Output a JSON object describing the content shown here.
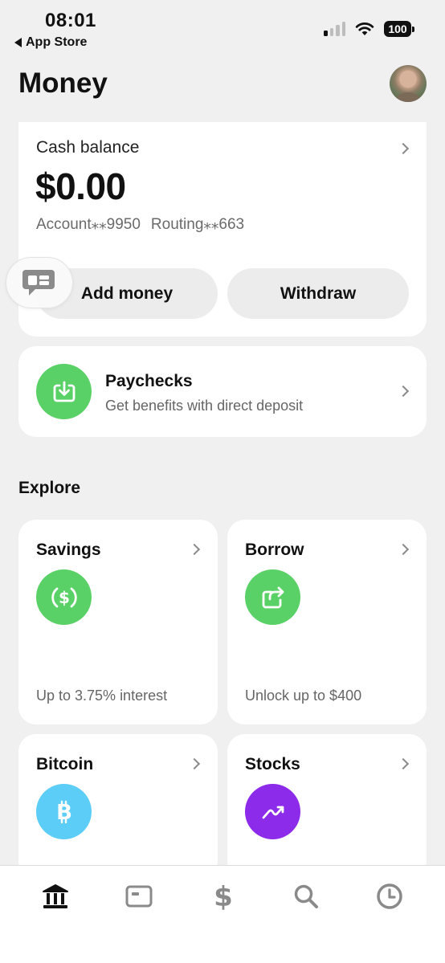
{
  "status": {
    "time": "08:01",
    "back_label": "App Store",
    "battery": "100"
  },
  "header": {
    "title": "Money"
  },
  "cash": {
    "label": "Cash balance",
    "amount": "$0.00",
    "account": "Account⁎⁎9950",
    "routing": "Routing⁎⁎663",
    "add_money": "Add money",
    "withdraw": "Withdraw"
  },
  "paychecks": {
    "title": "Paychecks",
    "subtitle": "Get benefits with direct deposit"
  },
  "explore": {
    "title": "Explore",
    "tiles": [
      {
        "title": "Savings",
        "subtitle": "Up to 3.75% interest",
        "icon": "dollar-circle-icon",
        "color": "#5ad166"
      },
      {
        "title": "Borrow",
        "subtitle": "Unlock up to $400",
        "icon": "borrow-arrow-icon",
        "color": "#5ad166"
      },
      {
        "title": "Bitcoin",
        "subtitle": "",
        "icon": "bitcoin-icon",
        "color": "#5ccdf6"
      },
      {
        "title": "Stocks",
        "subtitle": "",
        "icon": "stocks-trend-icon",
        "color": "#8c2bea"
      }
    ]
  },
  "tabbar": {
    "items": [
      {
        "name": "money",
        "icon": "bank-icon",
        "active": true
      },
      {
        "name": "card",
        "icon": "card-icon",
        "active": false
      },
      {
        "name": "pay",
        "icon": "dollar-icon",
        "active": false
      },
      {
        "name": "search",
        "icon": "search-icon",
        "active": false
      },
      {
        "name": "activity",
        "icon": "clock-icon",
        "active": false
      }
    ]
  },
  "colors": {
    "accent_green": "#5ad166",
    "background": "#f0f0f0",
    "inactive_icon": "#8a8a8a"
  }
}
